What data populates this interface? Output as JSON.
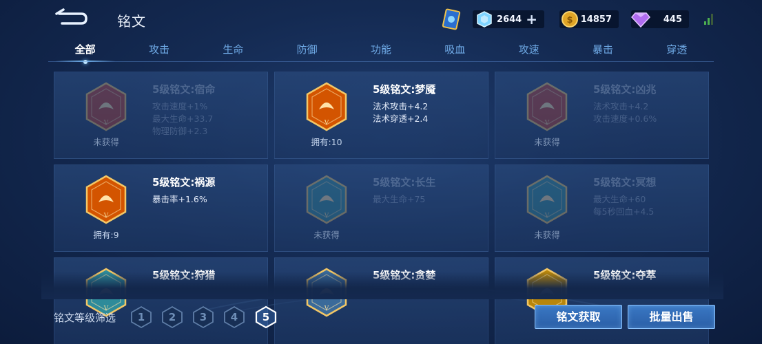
{
  "header": {
    "title": "铭文",
    "resources": {
      "crystal": "2644",
      "gold": "14857",
      "diamond": "445"
    }
  },
  "tabs": [
    "全部",
    "攻击",
    "生命",
    "防御",
    "功能",
    "吸血",
    "攻速",
    "暴击",
    "穿透"
  ],
  "active_tab": 0,
  "runes": [
    {
      "name": "5级铭文:宿命",
      "stats": [
        "攻击速度+1%",
        "最大生命+33.7",
        "物理防御+2.3"
      ],
      "status": "未获得",
      "owned": false,
      "color": "#c0392b"
    },
    {
      "name": "5级铭文:梦魇",
      "stats": [
        "法术攻击+4.2",
        "法术穿透+2.4"
      ],
      "status": "拥有:10",
      "owned": true,
      "color": "#d35400"
    },
    {
      "name": "5级铭文:凶兆",
      "stats": [
        "法术攻击+4.2",
        "攻击速度+0.6%"
      ],
      "status": "未获得",
      "owned": false,
      "color": "#c0392b"
    },
    {
      "name": "5级铭文:祸源",
      "stats": [
        "暴击率+1.6%"
      ],
      "status": "拥有:9",
      "owned": true,
      "color": "#d35400"
    },
    {
      "name": "5级铭文:长生",
      "stats": [
        "最大生命+75"
      ],
      "status": "未获得",
      "owned": false,
      "color": "#2e8b9a"
    },
    {
      "name": "5级铭文:冥想",
      "stats": [
        "最大生命+60",
        "每5秒回血+4.5"
      ],
      "status": "未获得",
      "owned": false,
      "color": "#2e8b9a"
    },
    {
      "name": "5级铭文:狩猎",
      "stats": [],
      "status": "",
      "owned": true,
      "color": "#2e8b9a"
    },
    {
      "name": "5级铭文:贪婪",
      "stats": [],
      "status": "",
      "owned": true,
      "color": "#3a6a9a"
    },
    {
      "name": "5级铭文:夺萃",
      "stats": [],
      "status": "",
      "owned": true,
      "color": "#b8860b"
    }
  ],
  "footer": {
    "filter_label": "铭文等级筛选",
    "levels": [
      "1",
      "2",
      "3",
      "4",
      "5"
    ],
    "selected_level": "5",
    "acquire_button": "铭文获取",
    "bulk_sell_button": "批量出售"
  }
}
